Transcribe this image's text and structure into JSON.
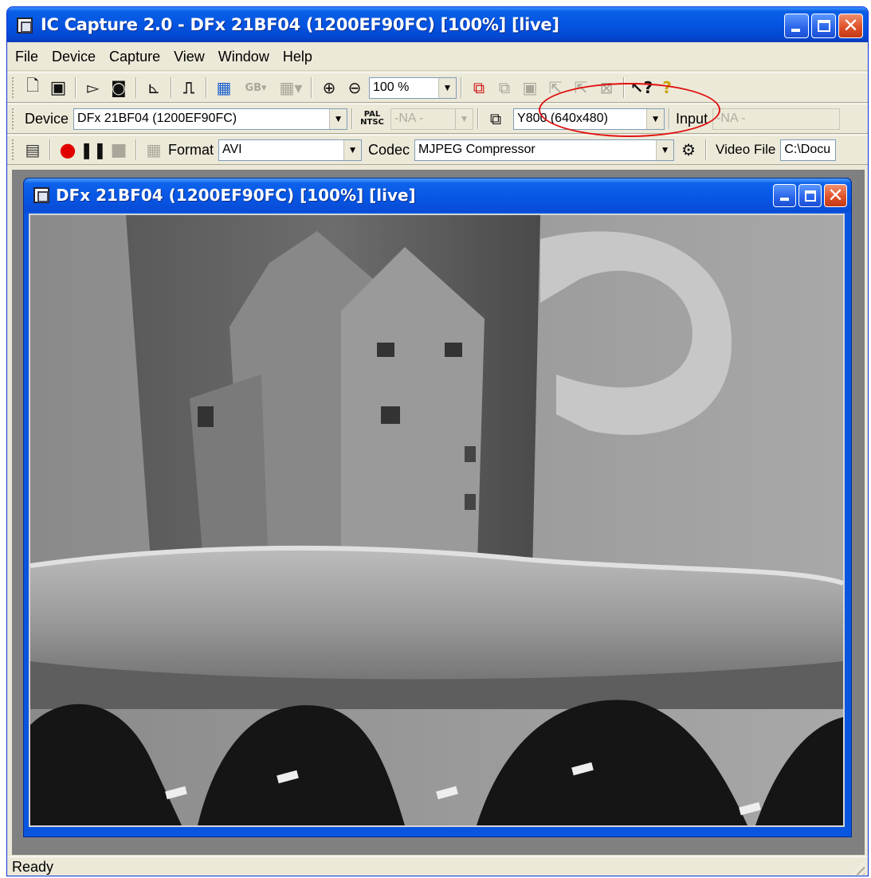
{
  "window": {
    "title": "IC Capture 2.0 - DFx 21BF04 (1200EF90FC) [100%]  [live]"
  },
  "menu": [
    "File",
    "Device",
    "Capture",
    "View",
    "Window",
    "Help"
  ],
  "toolbar1": {
    "zoom_value": "100 %",
    "gb_label": "GB"
  },
  "toolbar2": {
    "device_label": "Device",
    "device_value": "DFx 21BF04 (1200EF90FC)",
    "pal_top": "PAL",
    "pal_bottom": "NTSC",
    "video_norm_value": "-NA -",
    "video_format_value": "Y800 (640x480)",
    "input_label": "Input",
    "input_value": "-NA -"
  },
  "toolbar3": {
    "format_label": "Format",
    "format_value": "AVI",
    "codec_label": "Codec",
    "codec_value": "MJPEG Compressor",
    "video_file_label": "Video File",
    "video_file_value": "C:\\Docu"
  },
  "child_window": {
    "title": "DFx 21BF04 (1200EF90FC) [100%]  [live]"
  },
  "status": {
    "text": "Ready"
  },
  "colors": {
    "titlebar": "#0454e1",
    "highlight": "#e01010",
    "record": "#e00000"
  }
}
